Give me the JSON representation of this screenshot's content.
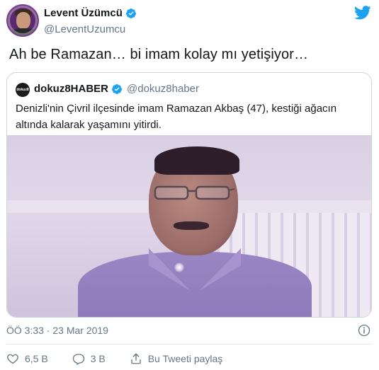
{
  "author": {
    "name": "Levent Üzümcü",
    "handle": "@LeventUzumcu"
  },
  "tweet": {
    "text": "Ah be Ramazan… bi imam kolay mı yetişiyor…",
    "timestamp": "ÖÖ 3:33 · 23 Mar 2019"
  },
  "quoted": {
    "name": "dokuz8HABER",
    "handle": "@dokuz8haber",
    "avatar_text": "dokuz8",
    "text": "Denizli'nin Çivril ilçesinde imam Ramazan Akbaş (47), kestiği ağacın altında kalarak yaşamını yitirdi."
  },
  "actions": {
    "like_count": "6,5 B",
    "reply_count": "3 B",
    "share_label": "Bu Tweeti paylaş"
  },
  "colors": {
    "verified": "#1da1f2",
    "twitter_brand": "#1da1f2",
    "muted": "#657786",
    "border": "#ccd6dd"
  },
  "icons": [
    "verified-badge-icon",
    "twitter-bird-icon",
    "info-icon",
    "heart-icon",
    "reply-icon",
    "share-icon"
  ]
}
